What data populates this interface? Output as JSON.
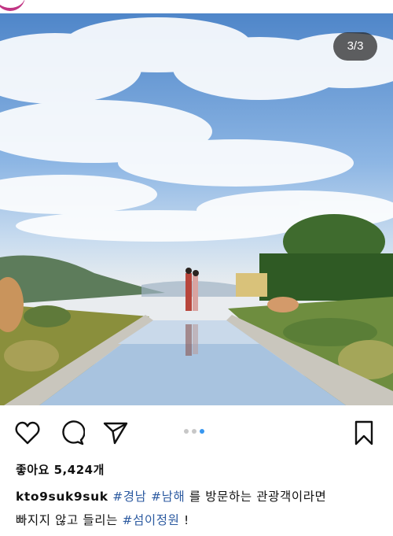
{
  "photo": {
    "counter": "3/3",
    "alt_icon": "garden-reflecting-pool-photo"
  },
  "actions": {
    "icons": [
      "heart-icon",
      "comment-icon",
      "send-icon",
      "bookmark-icon"
    ],
    "carousel": {
      "total": 3,
      "active_index": 2
    }
  },
  "post": {
    "likes": "좋아요 5,424개",
    "username": "kto9suk9suk",
    "tag1": "#경남",
    "tag2": "#남해",
    "caption_part1": " 를 방문하는 관광객이라면",
    "caption_part2": "빠지지 않고 들리는 ",
    "tag3": "#섬이정원",
    "caption_end": " !"
  },
  "colors": {
    "accent_blue": "#3897f0",
    "hashtag": "#2c5aa0",
    "logo_magenta": "#c13584"
  }
}
